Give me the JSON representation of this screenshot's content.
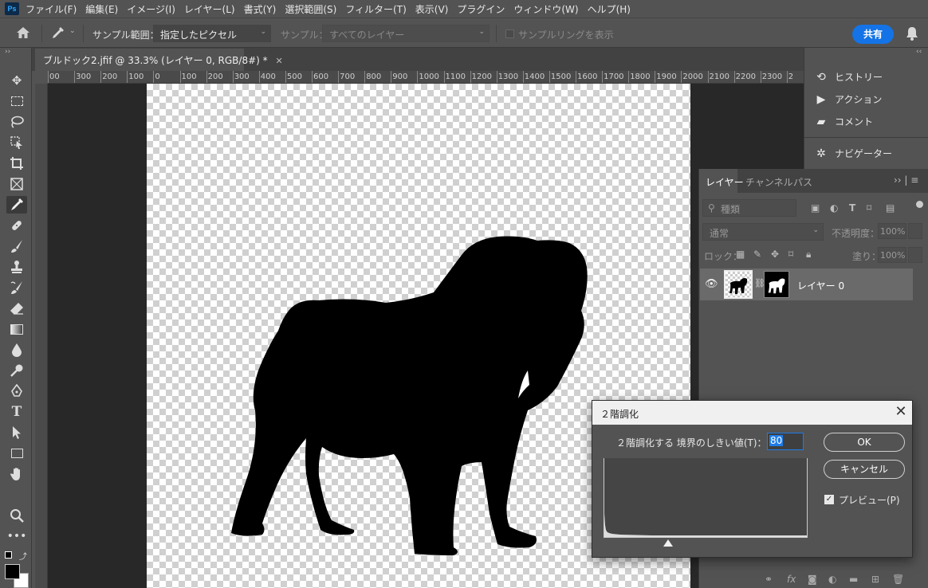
{
  "app": {
    "logo": "Ps"
  },
  "menu": [
    "ファイル(F)",
    "編集(E)",
    "イメージ(I)",
    "レイヤー(L)",
    "書式(Y)",
    "選択範囲(S)",
    "フィルター(T)",
    "表示(V)",
    "プラグイン",
    "ウィンドウ(W)",
    "ヘルプ(H)"
  ],
  "options": {
    "sample_size_label": "サンプル範囲：",
    "sample_size_value": "指定したピクセル",
    "sample_label": "サンプル：",
    "sample_value": "すべてのレイヤー",
    "show_ring_label": "サンプルリングを表示",
    "share": "共有"
  },
  "document": {
    "tab_title": "ブルドック2.jfif @ 33.3% (レイヤー 0, RGB/8#) *",
    "ruler_h": [
      "00",
      "300",
      "200",
      "100",
      "0",
      "100",
      "200",
      "300",
      "400",
      "500",
      "600",
      "700",
      "800",
      "900",
      "1000",
      "1100",
      "1200",
      "1300",
      "1400",
      "1500",
      "1600",
      "1700",
      "1800",
      "1900",
      "2000",
      "2100",
      "2200",
      "2300",
      "2"
    ]
  },
  "right_panels": {
    "history": "ヒストリー",
    "actions": "アクション",
    "comments": "コメント",
    "navigator": "ナビゲーター"
  },
  "layers_panel": {
    "tabs": [
      "レイヤー",
      "チャンネル",
      "パス"
    ],
    "filter_placeholder": "種類",
    "blend_mode": "通常",
    "opacity_label": "不透明度：",
    "opacity_value": "100%",
    "lock_label": "ロック：",
    "fill_label": "塗り：",
    "fill_value": "100%",
    "layer_name": "レイヤー 0"
  },
  "threshold_dialog": {
    "title": "２階調化",
    "threshold_label": "２階調化する 境界のしきい値(T)：",
    "threshold_value": "80",
    "ok": "OK",
    "cancel": "キャンセル",
    "preview_label": "プレビュー(P)",
    "preview_checked": true
  }
}
